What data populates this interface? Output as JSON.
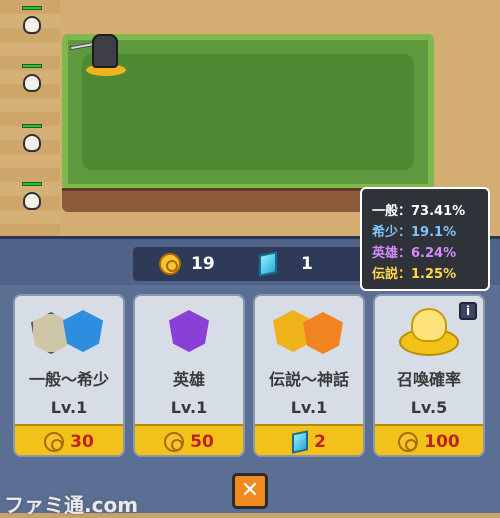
{
  "tooltip": {
    "lines": [
      {
        "label": "一般：73.41%",
        "color": "#ffffff"
      },
      {
        "label": "希少：19.1%",
        "color": "#7fc4ff"
      },
      {
        "label": "英雄：6.24%",
        "color": "#d28cff"
      },
      {
        "label": "伝説：1.25%",
        "color": "#ffd84a"
      }
    ]
  },
  "currency": {
    "coins": "19",
    "gems": "1"
  },
  "cards": [
    {
      "title": "一般～希少",
      "level": "Lv.1",
      "cost": "30",
      "cost_icon": "coin-icon"
    },
    {
      "title": "英雄",
      "level": "Lv.1",
      "cost": "50",
      "cost_icon": "coin-icon"
    },
    {
      "title": "伝説～神話",
      "level": "Lv.1",
      "cost": "2",
      "cost_icon": "gem-icon"
    },
    {
      "title": "召喚確率",
      "level": "Lv.5",
      "cost": "100",
      "cost_icon": "coin-icon"
    }
  ],
  "info_label": "i",
  "close_label": "✕",
  "watermark": "ファミ通.com",
  "colors": {
    "coin": "#f7c531",
    "cost_text": "#c0221b",
    "close": "#f08a1e",
    "panel": "#5b6e93"
  }
}
